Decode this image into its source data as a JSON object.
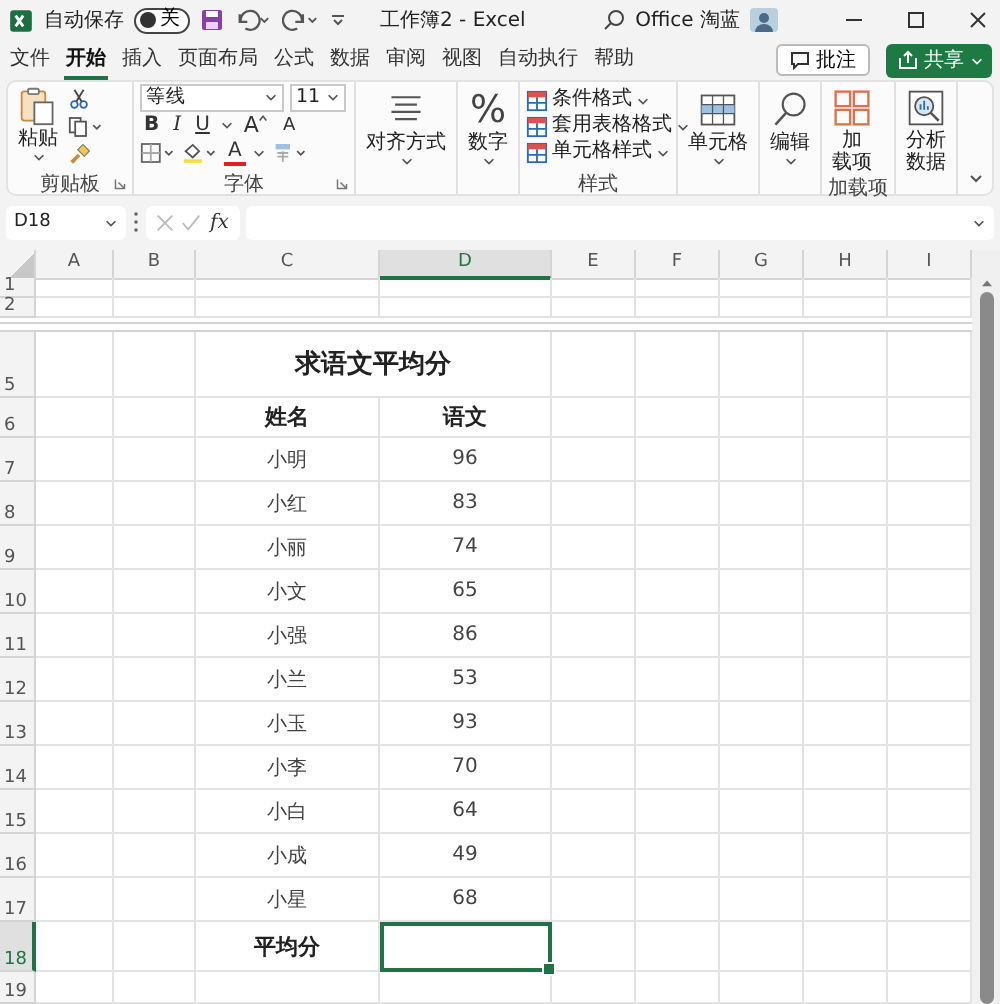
{
  "title_bar": {
    "autosave_label": "自动保存",
    "autosave_toggle": {
      "label": "关",
      "on": false
    },
    "title": "工作簿2 - Excel",
    "user": "Office 淘蓝"
  },
  "menu_tabs": [
    {
      "label": "文件",
      "selected": false
    },
    {
      "label": "开始",
      "selected": true
    },
    {
      "label": "插入",
      "selected": false
    },
    {
      "label": "页面布局",
      "selected": false
    },
    {
      "label": "公式",
      "selected": false
    },
    {
      "label": "数据",
      "selected": false
    },
    {
      "label": "审阅",
      "selected": false
    },
    {
      "label": "视图",
      "selected": false
    },
    {
      "label": "自动执行",
      "selected": false
    },
    {
      "label": "帮助",
      "selected": false
    }
  ],
  "comment_button": "批注",
  "share_button": "共享",
  "ribbon": {
    "clipboard": {
      "paste": "粘贴",
      "label": "剪贴板"
    },
    "font": {
      "name": "等线",
      "size": "11",
      "bold": "B",
      "italic": "I",
      "underline": "U",
      "grow": "A",
      "shrink": "A",
      "font_color": "A",
      "label": "字体"
    },
    "alignment": "对齐方式",
    "number": {
      "symbol": "%",
      "label": "数字"
    },
    "styles": {
      "items": [
        "条件格式",
        "套用表格格式",
        "单元格样式"
      ],
      "label": "样式"
    },
    "cells": "单元格",
    "editing": "编辑",
    "addins": {
      "lines": [
        "加",
        "载项"
      ],
      "label": "加载项"
    },
    "analyze": {
      "lines": [
        "分析",
        "数据"
      ]
    }
  },
  "formula_bar": {
    "name_box": "D18",
    "fx": "fx"
  },
  "sheet": {
    "columns": [
      {
        "label": "A",
        "selected": false
      },
      {
        "label": "B",
        "selected": false
      },
      {
        "label": "C",
        "selected": false
      },
      {
        "label": "D",
        "selected": true
      },
      {
        "label": "E",
        "selected": false
      },
      {
        "label": "F",
        "selected": false
      },
      {
        "label": "G",
        "selected": false
      },
      {
        "label": "H",
        "selected": false
      },
      {
        "label": "I",
        "selected": false
      }
    ],
    "rows": [
      {
        "label": "1",
        "kind": "blank",
        "selected": false
      },
      {
        "label": "2",
        "kind": "blank",
        "selected": false
      },
      {
        "label": "5",
        "kind": "title",
        "text": "求语文平均分",
        "selected": false
      },
      {
        "label": "6",
        "kind": "header",
        "c": "姓名",
        "d": "语文",
        "selected": false
      },
      {
        "label": "7",
        "kind": "data",
        "c": "小明",
        "d": "96",
        "selected": false
      },
      {
        "label": "8",
        "kind": "data",
        "c": "小红",
        "d": "83",
        "selected": false
      },
      {
        "label": "9",
        "kind": "data",
        "c": "小丽",
        "d": "74",
        "selected": false
      },
      {
        "label": "10",
        "kind": "data",
        "c": "小文",
        "d": "65",
        "selected": false
      },
      {
        "label": "11",
        "kind": "data",
        "c": "小强",
        "d": "86",
        "selected": false
      },
      {
        "label": "12",
        "kind": "data",
        "c": "小兰",
        "d": "53",
        "selected": false
      },
      {
        "label": "13",
        "kind": "data",
        "c": "小玉",
        "d": "93",
        "selected": false
      },
      {
        "label": "14",
        "kind": "data",
        "c": "小李",
        "d": "70",
        "selected": false
      },
      {
        "label": "15",
        "kind": "data",
        "c": "小白",
        "d": "64",
        "selected": false
      },
      {
        "label": "16",
        "kind": "data",
        "c": "小成",
        "d": "49",
        "selected": false
      },
      {
        "label": "17",
        "kind": "data",
        "c": "小星",
        "d": "68",
        "selected": false
      },
      {
        "label": "18",
        "kind": "total",
        "c": "平均分",
        "selected": true
      },
      {
        "label": "19",
        "kind": "blank",
        "selected": false
      }
    ]
  }
}
